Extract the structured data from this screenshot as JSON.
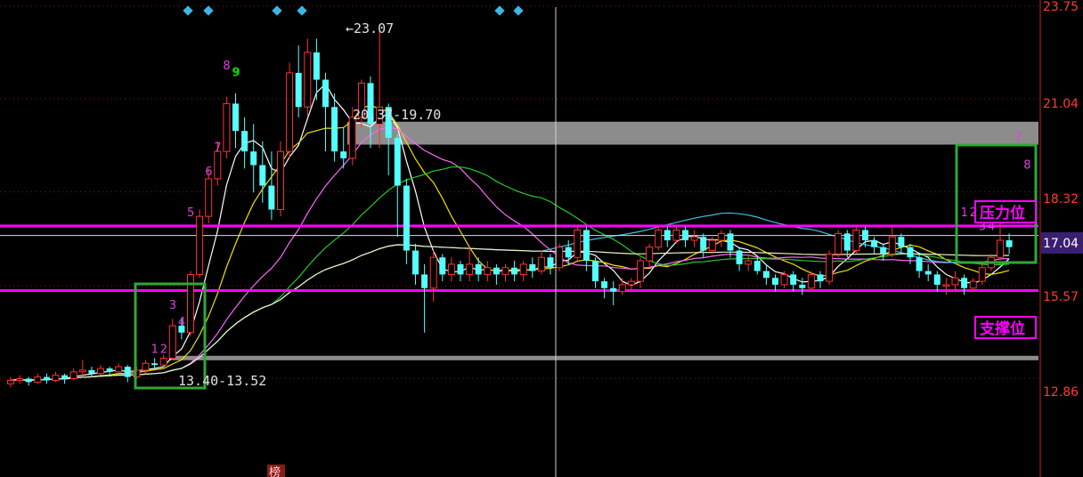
{
  "chart_data": {
    "type": "candlestick",
    "y_axis_ticks": [
      "23.75",
      "21.04",
      "18.32",
      "17.04",
      "15.57",
      "12.86"
    ],
    "current_price_label": "17.04",
    "ylim": [
      11.9,
      23.75
    ],
    "x_count": 112,
    "annotations": {
      "high_label": "23.07",
      "resistance_zone_label": "20.37-19.70",
      "support_zone_label": "13.40-13.52",
      "resistance_tag": "压力位",
      "support_tag": "支撑位",
      "bottom_marker": "榜"
    },
    "zones": [
      {
        "from": 19.7,
        "to": 20.37,
        "color": "#8c8c8c"
      },
      {
        "from": 13.4,
        "to": 13.52,
        "color": "#8c8c8c"
      }
    ],
    "h_lines": [
      {
        "y": 17.32,
        "color": "#ff00ff",
        "width": 3
      },
      {
        "y": 15.43,
        "color": "#ff00ff",
        "width": 3
      },
      {
        "y": 17.04,
        "color": "#dddddd",
        "width": 1
      }
    ],
    "seq_labels": [
      {
        "i": 16,
        "y": 13.6,
        "text": "1"
      },
      {
        "i": 17,
        "y": 13.6,
        "text": "2"
      },
      {
        "i": 18,
        "y": 14.9,
        "text": "3"
      },
      {
        "i": 19,
        "y": 14.4,
        "text": "4"
      },
      {
        "i": 20,
        "y": 17.6,
        "text": "5"
      },
      {
        "i": 22,
        "y": 18.8,
        "text": "6"
      },
      {
        "i": 23,
        "y": 19.5,
        "text": "7"
      },
      {
        "i": 24,
        "y": 21.9,
        "text": "8"
      },
      {
        "i": 25,
        "y": 21.7,
        "text": "9",
        "color": "#00e000"
      },
      {
        "i": 106,
        "y": 17.6,
        "text": "1"
      },
      {
        "i": 107,
        "y": 17.6,
        "text": "2"
      },
      {
        "i": 108,
        "y": 17.2,
        "text": "3"
      },
      {
        "i": 109,
        "y": 17.2,
        "text": "4"
      },
      {
        "i": 112,
        "y": 19.8,
        "text": "7"
      },
      {
        "i": 113,
        "y": 19.0,
        "text": "8"
      }
    ],
    "diamonds": [
      21,
      23,
      31,
      34,
      56,
      58
    ],
    "candles": [
      [
        12.7,
        12.8,
        12.6,
        12.9
      ],
      [
        12.8,
        12.85,
        12.7,
        12.95
      ],
      [
        12.85,
        12.75,
        12.65,
        12.9
      ],
      [
        12.75,
        12.9,
        12.7,
        13.0
      ],
      [
        12.9,
        12.8,
        12.7,
        13.0
      ],
      [
        12.8,
        12.95,
        12.75,
        13.05
      ],
      [
        12.95,
        12.85,
        12.7,
        13.0
      ],
      [
        12.85,
        13.05,
        12.8,
        13.15
      ],
      [
        13.05,
        13.1,
        12.95,
        13.4
      ],
      [
        13.1,
        13.0,
        12.9,
        13.2
      ],
      [
        13.0,
        13.15,
        12.95,
        13.25
      ],
      [
        13.15,
        13.05,
        12.95,
        13.2
      ],
      [
        13.05,
        13.2,
        13.0,
        13.3
      ],
      [
        13.2,
        12.9,
        12.75,
        13.25
      ],
      [
        12.9,
        13.1,
        12.85,
        13.2
      ],
      [
        13.1,
        13.3,
        13.0,
        13.4
      ],
      [
        13.3,
        13.25,
        13.15,
        13.45
      ],
      [
        13.25,
        13.45,
        13.2,
        13.55
      ],
      [
        13.45,
        14.4,
        13.4,
        14.6
      ],
      [
        14.4,
        14.2,
        14.0,
        14.6
      ],
      [
        14.2,
        15.9,
        14.1,
        16.0
      ],
      [
        15.9,
        17.6,
        15.8,
        17.8
      ],
      [
        17.6,
        18.7,
        17.4,
        19.0
      ],
      [
        18.7,
        19.5,
        18.5,
        19.8
      ],
      [
        19.5,
        20.9,
        19.3,
        21.1
      ],
      [
        20.9,
        20.1,
        19.6,
        21.2
      ],
      [
        20.1,
        19.5,
        19.0,
        20.5
      ],
      [
        19.5,
        19.1,
        18.3,
        20.3
      ],
      [
        19.1,
        18.5,
        18.0,
        19.8
      ],
      [
        18.5,
        17.8,
        17.5,
        19.5
      ],
      [
        17.8,
        19.5,
        17.6,
        19.8
      ],
      [
        19.5,
        21.8,
        19.3,
        22.1
      ],
      [
        21.8,
        20.8,
        20.5,
        22.6
      ],
      [
        20.8,
        22.4,
        20.5,
        22.8
      ],
      [
        22.4,
        21.6,
        21.0,
        22.8
      ],
      [
        21.6,
        20.8,
        19.5,
        21.8
      ],
      [
        20.8,
        19.5,
        19.2,
        21.2
      ],
      [
        19.5,
        19.3,
        19.0,
        20.2
      ],
      [
        19.3,
        20.5,
        19.1,
        20.8
      ],
      [
        20.5,
        21.5,
        20.2,
        21.6
      ],
      [
        21.5,
        20.3,
        19.6,
        21.7
      ],
      [
        20.3,
        20.8,
        19.6,
        23.07
      ],
      [
        20.8,
        19.9,
        18.8,
        20.9
      ],
      [
        19.9,
        18.5,
        17.0,
        20.0
      ],
      [
        18.5,
        16.6,
        16.2,
        18.7
      ],
      [
        16.6,
        15.9,
        15.6,
        16.8
      ],
      [
        15.9,
        15.5,
        14.2,
        16.2
      ],
      [
        15.5,
        16.4,
        15.1,
        16.6
      ],
      [
        16.4,
        15.9,
        15.7,
        16.5
      ],
      [
        15.9,
        16.2,
        15.7,
        16.4
      ],
      [
        16.2,
        15.9,
        15.7,
        16.3
      ],
      [
        15.9,
        16.2,
        15.7,
        16.7
      ],
      [
        16.2,
        15.9,
        15.7,
        16.4
      ],
      [
        15.9,
        16.1,
        15.7,
        16.3
      ],
      [
        16.1,
        15.9,
        15.6,
        16.2
      ],
      [
        15.9,
        16.1,
        15.7,
        16.2
      ],
      [
        16.1,
        15.9,
        15.7,
        16.3
      ],
      [
        15.9,
        16.2,
        15.7,
        16.3
      ],
      [
        16.2,
        16.0,
        15.8,
        16.4
      ],
      [
        16.0,
        16.4,
        15.9,
        16.6
      ],
      [
        16.4,
        16.1,
        15.9,
        16.5
      ],
      [
        16.1,
        16.7,
        16.0,
        16.8
      ],
      [
        16.7,
        16.4,
        16.2,
        16.9
      ],
      [
        16.4,
        17.2,
        16.3,
        17.3
      ],
      [
        17.2,
        16.3,
        16.0,
        17.3
      ],
      [
        16.3,
        15.7,
        15.5,
        16.4
      ],
      [
        15.7,
        15.5,
        15.2,
        15.8
      ],
      [
        15.5,
        15.4,
        15.0,
        15.7
      ],
      [
        15.4,
        15.6,
        15.3,
        15.8
      ],
      [
        15.6,
        15.7,
        15.4,
        15.8
      ],
      [
        15.7,
        16.3,
        15.5,
        16.4
      ],
      [
        16.3,
        16.7,
        16.1,
        16.8
      ],
      [
        16.7,
        17.2,
        16.6,
        17.3
      ],
      [
        17.2,
        16.9,
        16.7,
        17.3
      ],
      [
        16.9,
        17.2,
        16.8,
        17.3
      ],
      [
        17.2,
        16.9,
        16.7,
        17.3
      ],
      [
        16.9,
        17.0,
        16.7,
        17.2
      ],
      [
        17.0,
        16.6,
        16.4,
        17.1
      ],
      [
        16.6,
        16.9,
        16.5,
        17.0
      ],
      [
        16.9,
        17.1,
        16.7,
        17.2
      ],
      [
        17.1,
        16.6,
        16.4,
        17.2
      ],
      [
        16.6,
        16.2,
        16.0,
        16.7
      ],
      [
        16.2,
        16.3,
        16.0,
        16.5
      ],
      [
        16.3,
        16.0,
        15.9,
        16.4
      ],
      [
        16.0,
        15.8,
        15.6,
        16.2
      ],
      [
        15.8,
        15.6,
        15.4,
        15.9
      ],
      [
        15.6,
        15.9,
        15.5,
        16.0
      ],
      [
        15.9,
        15.6,
        15.4,
        16.0
      ],
      [
        15.6,
        15.5,
        15.3,
        15.8
      ],
      [
        15.5,
        15.9,
        15.4,
        16.0
      ],
      [
        15.9,
        15.7,
        15.5,
        16.0
      ],
      [
        15.7,
        16.5,
        15.6,
        16.6
      ],
      [
        16.5,
        17.1,
        16.4,
        17.2
      ],
      [
        17.1,
        16.6,
        16.4,
        17.2
      ],
      [
        16.6,
        17.2,
        16.5,
        17.3
      ],
      [
        17.2,
        16.9,
        16.7,
        17.3
      ],
      [
        16.9,
        16.7,
        16.5,
        17.0
      ],
      [
        16.7,
        16.5,
        16.3,
        16.8
      ],
      [
        16.5,
        17.0,
        16.4,
        17.3
      ],
      [
        17.0,
        16.7,
        16.5,
        17.1
      ],
      [
        16.7,
        16.4,
        16.2,
        16.8
      ],
      [
        16.4,
        16.0,
        15.8,
        16.5
      ],
      [
        16.0,
        15.9,
        15.7,
        16.2
      ],
      [
        15.9,
        15.6,
        15.4,
        16.0
      ],
      [
        15.6,
        15.6,
        15.3,
        15.8
      ],
      [
        15.6,
        15.8,
        15.4,
        16.0
      ],
      [
        15.8,
        15.5,
        15.3,
        15.9
      ],
      [
        15.5,
        15.7,
        15.4,
        15.8
      ],
      [
        15.7,
        16.1,
        15.6,
        16.2
      ],
      [
        16.1,
        16.4,
        16.0,
        16.5
      ],
      [
        16.4,
        16.9,
        16.3,
        17.6
      ],
      [
        16.9,
        16.7,
        16.5,
        17.1
      ]
    ]
  }
}
